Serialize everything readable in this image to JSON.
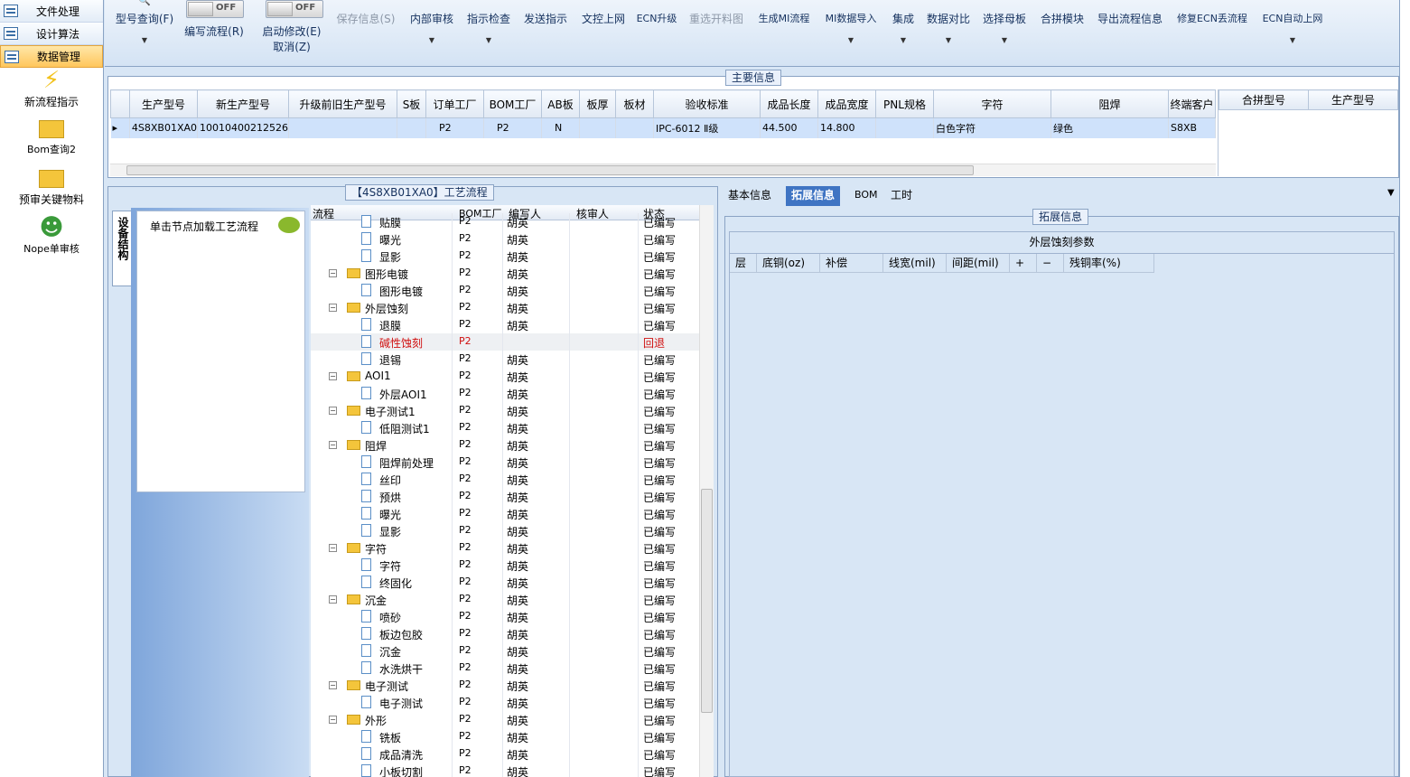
{
  "leftnav": {
    "menus": [
      {
        "label": "文件处理"
      },
      {
        "label": "设计算法"
      },
      {
        "label": "数据管理"
      }
    ],
    "items": [
      {
        "label": "新流程指示",
        "icon": "lightning-icon"
      },
      {
        "label": "Bom查询2",
        "icon": "folder-icon"
      },
      {
        "label": "预审关键物料",
        "icon": "folder-icon"
      },
      {
        "label": "Nope单审核",
        "icon": "user-icon"
      }
    ]
  },
  "ribbon": {
    "query_label": "型号查询(F)",
    "write_flow_label": "编写流程(R)",
    "write_flow_toggle": "OFF",
    "auto_edit_label": "启动修改(E)",
    "auto_edit_cancel": "取消(Z)",
    "auto_edit_toggle": "OFF",
    "save_label": "保存信息(S)",
    "internal_review": "内部审核",
    "instr_check": "指示检查",
    "send_instr": "发送指示",
    "doc_online": "文控上网",
    "ecn_upgrade": "ECN升级",
    "reselect_cut": "重选开料图",
    "gen_mi": "生成MI流程",
    "mi_import": "MI数据导入",
    "integrate": "集成",
    "data_compare": "数据对比",
    "select_mother": "选择母板",
    "combine_module": "合拼模块",
    "export_flow": "导出流程信息",
    "fix_ecn": "修复ECN丢流程",
    "ecn_auto": "ECN自动上网"
  },
  "main_info": {
    "title": "主要信息",
    "columns": [
      "生产型号",
      "新生产型号",
      "升级前旧生产型号",
      "S板",
      "订单工厂",
      "BOM工厂",
      "AB板",
      "板厚",
      "板材",
      "验收标准",
      "成品长度",
      "成品宽度",
      "PNL规格",
      "字符",
      "阻焊",
      "终端客户"
    ],
    "row": [
      "4S8XB01XA0",
      "10010400212526",
      "",
      "",
      "P2",
      "P2",
      "N",
      "",
      "",
      "IPC-6012 Ⅱ级",
      "44.500",
      "14.800",
      "",
      "白色字符",
      "绿色",
      "S8XB"
    ],
    "side_columns": [
      "合拼型号",
      "生产型号"
    ]
  },
  "flow": {
    "title": "【4S8XB01XA0】工艺流程",
    "side_tab": "设备结构",
    "hint": "单击节点加载工艺流程",
    "columns": [
      "流程",
      "BOM工厂",
      "编写人",
      "核审人",
      "状态"
    ],
    "rows": [
      {
        "level": 2,
        "name": "贴膜",
        "bom": "P2",
        "writer": "胡英",
        "status": "已编写"
      },
      {
        "level": 2,
        "name": "曝光",
        "bom": "P2",
        "writer": "胡英",
        "status": "已编写"
      },
      {
        "level": 2,
        "name": "显影",
        "bom": "P2",
        "writer": "胡英",
        "status": "已编写"
      },
      {
        "level": 1,
        "name": "图形电镀",
        "bom": "P2",
        "writer": "胡英",
        "status": "已编写"
      },
      {
        "level": 2,
        "name": "图形电镀",
        "bom": "P2",
        "writer": "胡英",
        "status": "已编写"
      },
      {
        "level": 1,
        "name": "外层蚀刻",
        "bom": "P2",
        "writer": "胡英",
        "status": "已编写"
      },
      {
        "level": 2,
        "name": "退膜",
        "bom": "P2",
        "writer": "胡英",
        "status": "已编写"
      },
      {
        "level": 2,
        "name": "碱性蚀刻",
        "bom": "P2",
        "writer": "",
        "status": "回退",
        "alert": true
      },
      {
        "level": 2,
        "name": "退锡",
        "bom": "P2",
        "writer": "胡英",
        "status": "已编写"
      },
      {
        "level": 1,
        "name": "AOI1",
        "bom": "P2",
        "writer": "胡英",
        "status": "已编写"
      },
      {
        "level": 2,
        "name": "外层AOI1",
        "bom": "P2",
        "writer": "胡英",
        "status": "已编写"
      },
      {
        "level": 1,
        "name": "电子测试1",
        "bom": "P2",
        "writer": "胡英",
        "status": "已编写"
      },
      {
        "level": 2,
        "name": "低阻测试1",
        "bom": "P2",
        "writer": "胡英",
        "status": "已编写"
      },
      {
        "level": 1,
        "name": "阻焊",
        "bom": "P2",
        "writer": "胡英",
        "status": "已编写"
      },
      {
        "level": 2,
        "name": "阻焊前处理",
        "bom": "P2",
        "writer": "胡英",
        "status": "已编写"
      },
      {
        "level": 2,
        "name": "丝印",
        "bom": "P2",
        "writer": "胡英",
        "status": "已编写"
      },
      {
        "level": 2,
        "name": "预烘",
        "bom": "P2",
        "writer": "胡英",
        "status": "已编写"
      },
      {
        "level": 2,
        "name": "曝光",
        "bom": "P2",
        "writer": "胡英",
        "status": "已编写"
      },
      {
        "level": 2,
        "name": "显影",
        "bom": "P2",
        "writer": "胡英",
        "status": "已编写"
      },
      {
        "level": 1,
        "name": "字符",
        "bom": "P2",
        "writer": "胡英",
        "status": "已编写"
      },
      {
        "level": 2,
        "name": "字符",
        "bom": "P2",
        "writer": "胡英",
        "status": "已编写"
      },
      {
        "level": 2,
        "name": "终固化",
        "bom": "P2",
        "writer": "胡英",
        "status": "已编写"
      },
      {
        "level": 1,
        "name": "沉金",
        "bom": "P2",
        "writer": "胡英",
        "status": "已编写"
      },
      {
        "level": 2,
        "name": "喷砂",
        "bom": "P2",
        "writer": "胡英",
        "status": "已编写"
      },
      {
        "level": 2,
        "name": "板边包胶",
        "bom": "P2",
        "writer": "胡英",
        "status": "已编写"
      },
      {
        "level": 2,
        "name": "沉金",
        "bom": "P2",
        "writer": "胡英",
        "status": "已编写"
      },
      {
        "level": 2,
        "name": "水洗烘干",
        "bom": "P2",
        "writer": "胡英",
        "status": "已编写"
      },
      {
        "level": 1,
        "name": "电子测试",
        "bom": "P2",
        "writer": "胡英",
        "status": "已编写"
      },
      {
        "level": 2,
        "name": "电子测试",
        "bom": "P2",
        "writer": "胡英",
        "status": "已编写"
      },
      {
        "level": 1,
        "name": "外形",
        "bom": "P2",
        "writer": "胡英",
        "status": "已编写"
      },
      {
        "level": 2,
        "name": "铣板",
        "bom": "P2",
        "writer": "胡英",
        "status": "已编写"
      },
      {
        "level": 2,
        "name": "成品清洗",
        "bom": "P2",
        "writer": "胡英",
        "status": "已编写"
      },
      {
        "level": 2,
        "name": "小板切割",
        "bom": "P2",
        "writer": "胡英",
        "status": "已编写"
      }
    ]
  },
  "right": {
    "tabs": [
      "基本信息",
      "拓展信息",
      "BOM",
      "工时"
    ],
    "active_tab": 1,
    "section_title": "拓展信息",
    "table_title": "外层蚀刻参数",
    "columns": [
      "层",
      "底铜(oz)",
      "补偿",
      "线宽(mil)",
      "间距(mil)",
      "+",
      "−",
      "残铜率(%)"
    ]
  },
  "colors": {
    "accent": "#3f74c3",
    "selected_row": "#cfe2fb",
    "active_menu": "#ffc65c",
    "alert": "#d01010"
  }
}
